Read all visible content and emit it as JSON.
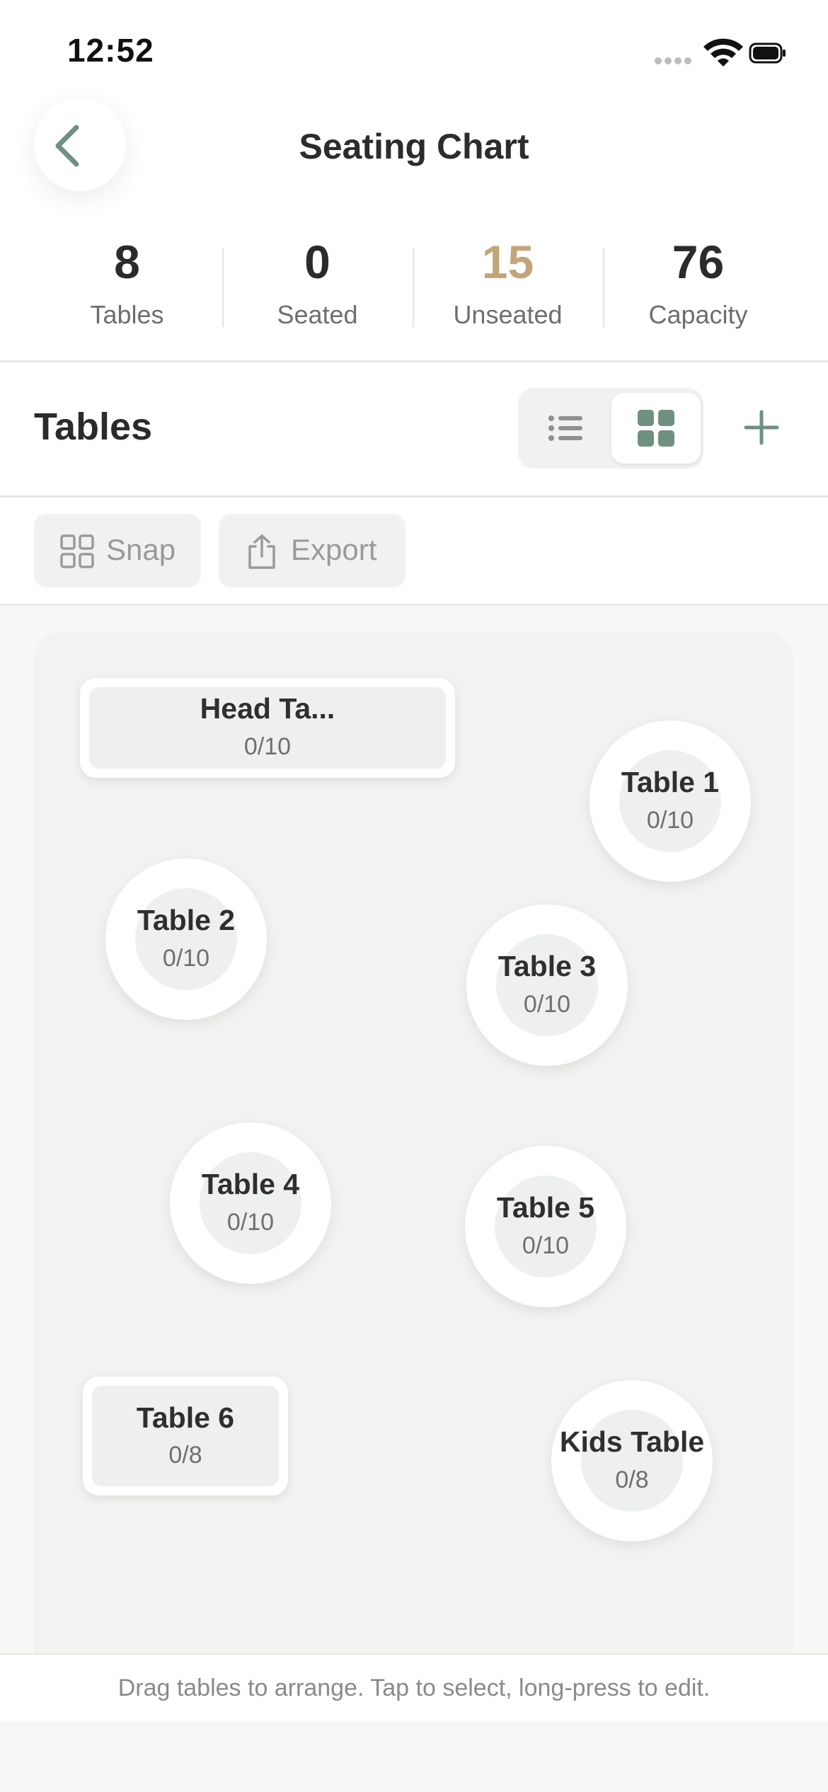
{
  "status_bar": {
    "time": "12:52"
  },
  "header": {
    "title": "Seating Chart"
  },
  "stats": [
    {
      "value": "8",
      "label": "Tables"
    },
    {
      "value": "0",
      "label": "Seated"
    },
    {
      "value": "15",
      "label": "Unseated"
    },
    {
      "value": "76",
      "label": "Capacity"
    }
  ],
  "section": {
    "title": "Tables",
    "view_mode": "grid"
  },
  "actions": {
    "snap": "Snap",
    "export": "Export"
  },
  "tables": [
    {
      "name": "Head Ta...",
      "count": "0/10",
      "shape": "rect"
    },
    {
      "name": "Table 1",
      "count": "0/10",
      "shape": "round"
    },
    {
      "name": "Table 2",
      "count": "0/10",
      "shape": "round"
    },
    {
      "name": "Table 3",
      "count": "0/10",
      "shape": "round"
    },
    {
      "name": "Table 4",
      "count": "0/10",
      "shape": "round"
    },
    {
      "name": "Table 5",
      "count": "0/10",
      "shape": "round"
    },
    {
      "name": "Table 6",
      "count": "0/8",
      "shape": "rect"
    },
    {
      "name": "Kids Table",
      "count": "0/8",
      "shape": "round"
    }
  ],
  "footer": {
    "hint": "Drag tables to arrange. Tap to select, long-press to edit."
  },
  "colors": {
    "accent_green": "#6f9081",
    "unseated_accent": "#c4a57a"
  }
}
